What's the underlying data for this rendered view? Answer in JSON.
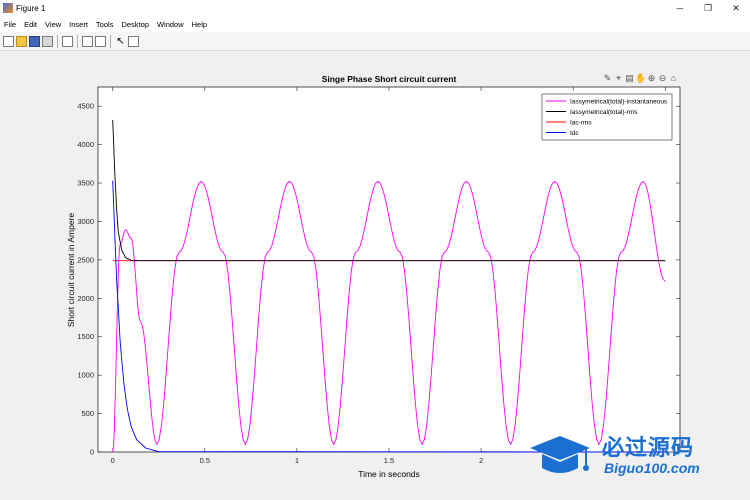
{
  "window": {
    "title": "Figure 1",
    "minimize": "─",
    "maximize": "❐",
    "close": "✕"
  },
  "menu": [
    "File",
    "Edit",
    "View",
    "Insert",
    "Tools",
    "Desktop",
    "Window",
    "Help"
  ],
  "axes_toolbar": [
    "✎",
    "⌖",
    "▤",
    "✋",
    "⊕",
    "⊖",
    "⌂"
  ],
  "watermark": {
    "cn": "必过源码",
    "en": "Biguo100.com"
  },
  "chart_data": {
    "type": "line",
    "title": "Singe Phase Short circuit current",
    "xlabel": "Time in seconds",
    "ylabel": "Short circuit current in Ampere",
    "xlim": [
      -0.08,
      3.08
    ],
    "ylim": [
      0,
      4750
    ],
    "xticks": [
      0,
      0.5,
      1,
      1.5,
      2,
      2.5,
      3
    ],
    "xtick_labels": [
      "0",
      "0.5",
      "1",
      "1.5",
      "2",
      "",
      ""
    ],
    "yticks": [
      0,
      500,
      1000,
      1500,
      2000,
      2500,
      3000,
      3500,
      4000,
      4500
    ],
    "ytick_labels": [
      "0",
      "500",
      "1000",
      "1500",
      "2000",
      "2500",
      "3000",
      "3500",
      "4000",
      "4500"
    ],
    "grid": false,
    "legend_position": "top-right",
    "series": [
      {
        "name": "Iassymetrical(total)-instantaneous",
        "color": "#ff00ff",
        "points": [
          [
            0,
            0
          ],
          [
            0.04,
            2700
          ],
          [
            0.07,
            2890
          ],
          [
            0.1,
            2780
          ],
          [
            0.15,
            1700
          ],
          [
            0.24,
            100
          ],
          [
            0.36,
            2600
          ],
          [
            0.48,
            3520
          ],
          [
            0.6,
            2600
          ],
          [
            0.72,
            100
          ],
          [
            0.84,
            2600
          ],
          [
            0.96,
            3520
          ],
          [
            1.08,
            2600
          ],
          [
            1.2,
            100
          ],
          [
            1.32,
            2600
          ],
          [
            1.44,
            3520
          ],
          [
            1.56,
            2600
          ],
          [
            1.68,
            100
          ],
          [
            1.8,
            2600
          ],
          [
            1.92,
            3520
          ],
          [
            2.04,
            2600
          ],
          [
            2.16,
            100
          ],
          [
            2.28,
            2600
          ],
          [
            2.4,
            3520
          ],
          [
            2.52,
            2600
          ],
          [
            2.64,
            100
          ],
          [
            2.76,
            2600
          ],
          [
            2.88,
            3520
          ],
          [
            3.0,
            2220
          ]
        ]
      },
      {
        "name": "Iassymetrical(total)-rms",
        "color": "#000000",
        "points": [
          [
            0,
            4320
          ],
          [
            0.01,
            3700
          ],
          [
            0.02,
            3200
          ],
          [
            0.03,
            2860
          ],
          [
            0.05,
            2620
          ],
          [
            0.07,
            2530
          ],
          [
            0.1,
            2495
          ],
          [
            0.15,
            2490
          ],
          [
            3.0,
            2490
          ]
        ]
      },
      {
        "name": "Iac-rms",
        "color": "#ff0000",
        "points": [
          [
            0,
            2490
          ],
          [
            3.0,
            2490
          ]
        ]
      },
      {
        "name": "Idc",
        "color": "#0000ff",
        "points": [
          [
            0,
            3530
          ],
          [
            0.01,
            2900
          ],
          [
            0.02,
            2300
          ],
          [
            0.04,
            1450
          ],
          [
            0.06,
            900
          ],
          [
            0.08,
            550
          ],
          [
            0.1,
            330
          ],
          [
            0.13,
            160
          ],
          [
            0.18,
            50
          ],
          [
            0.25,
            5
          ],
          [
            3.0,
            0
          ]
        ]
      }
    ]
  }
}
